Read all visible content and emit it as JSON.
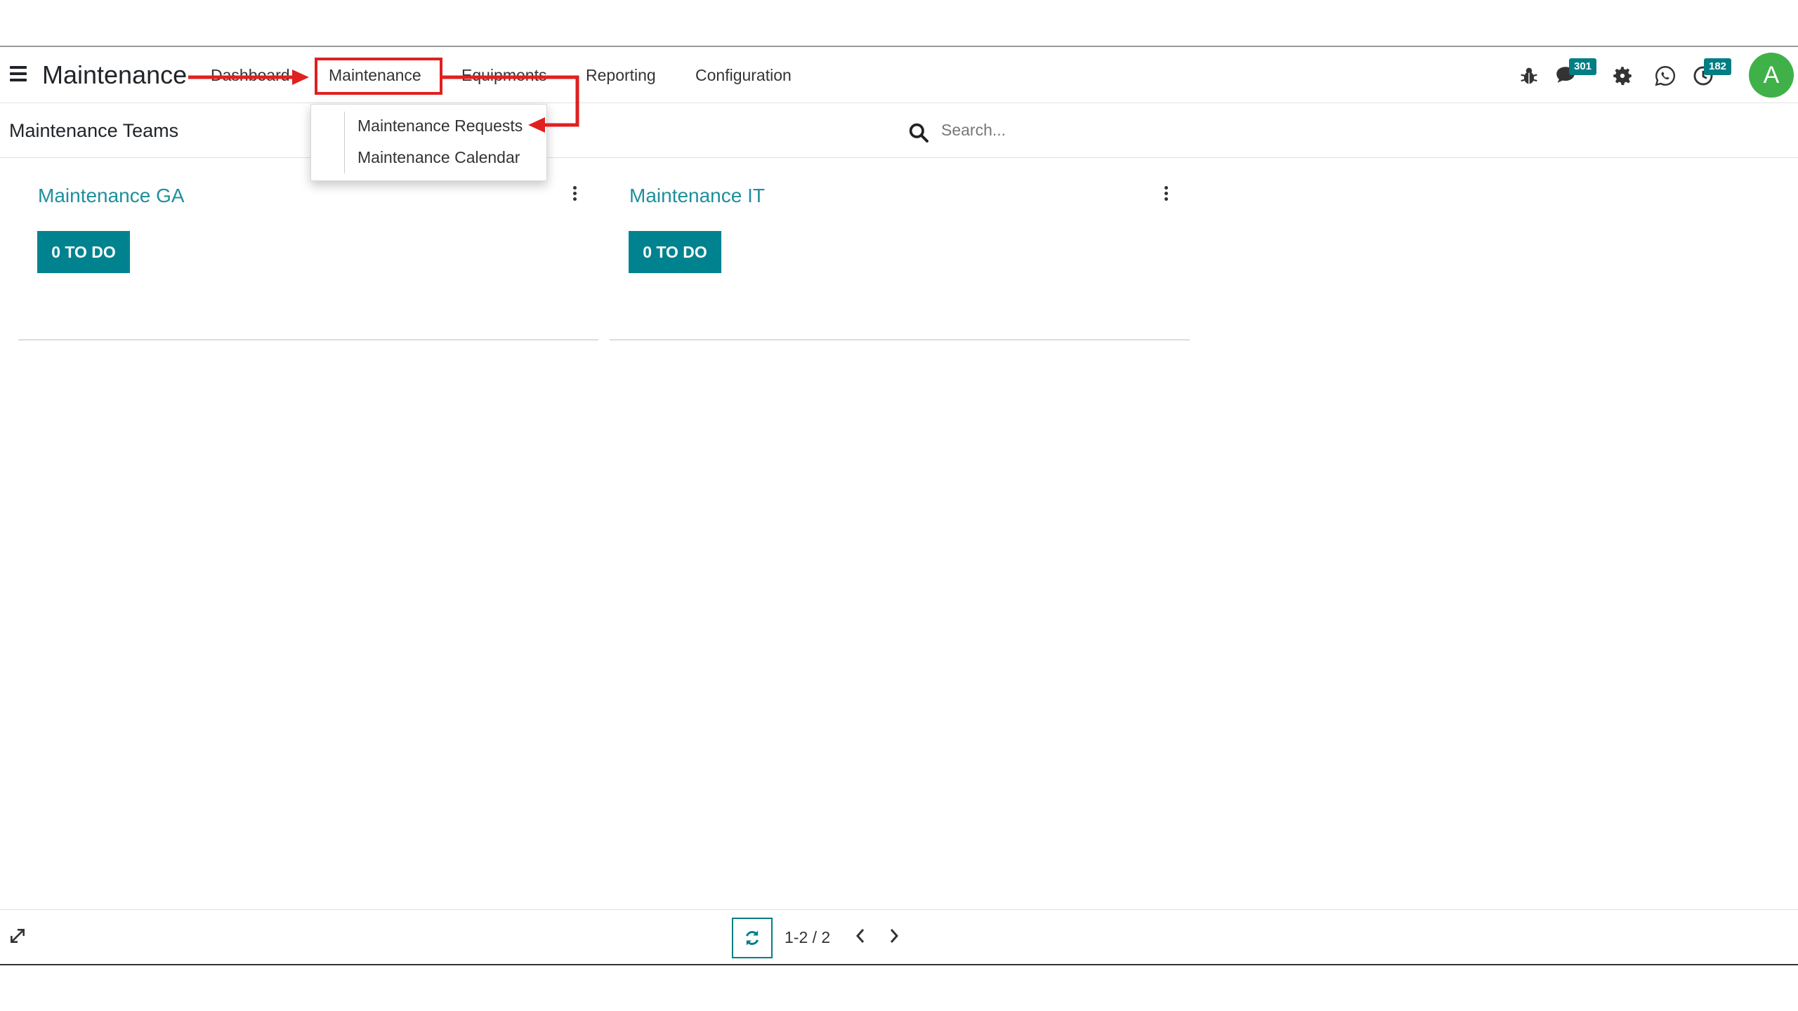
{
  "navbar": {
    "app_name": "Maintenance",
    "menu": {
      "dashboard": "Dashboard",
      "maintenance": "Maintenance",
      "equipments": "Equipments",
      "reporting": "Reporting",
      "configuration": "Configuration"
    },
    "icons": {
      "burger": "hamburger-menu-icon",
      "debug": "bug-icon",
      "messages": "chat-icon",
      "settings": "gear-icon",
      "whatsapp": "whatsapp-icon",
      "activities": "clock-icon"
    },
    "messages_count": "301",
    "activities_count": "182",
    "avatar_initial": "A"
  },
  "dropdown": {
    "requests": "Maintenance Requests",
    "calendar": "Maintenance Calendar"
  },
  "controlbar": {
    "breadcrumb": "Maintenance Teams",
    "search_placeholder": "Search..."
  },
  "teams": [
    {
      "name": "Maintenance GA",
      "todo_label": "0 TO DO"
    },
    {
      "name": "Maintenance IT",
      "todo_label": "0 TO DO"
    }
  ],
  "pager": {
    "value": "1-2 / 2"
  },
  "colors": {
    "accent": "#017e84",
    "title": "#1f8f9c",
    "annotation": "#e02020",
    "avatar": "#3fb148"
  }
}
